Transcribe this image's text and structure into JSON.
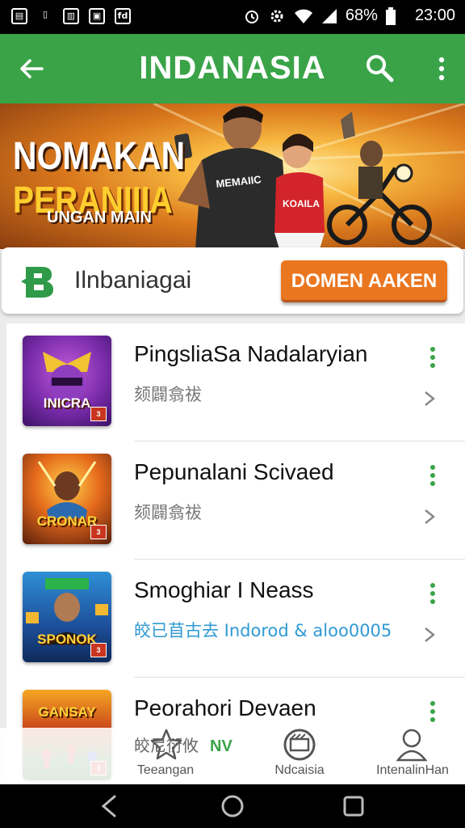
{
  "status_bar": {
    "battery": "68%",
    "time": "23:00"
  },
  "app_bar": {
    "title": "INDANASIA",
    "back_icon": "arrow-left-icon",
    "search_icon": "search-icon",
    "menu_icon": "more-vert-icon"
  },
  "banner": {
    "line1": "NOMAKAN",
    "line2": "PERANIIIA",
    "line3": "UNGAN MAIN",
    "shirt1": "MEMAIIC",
    "shirt2": "KOAILA"
  },
  "action_card": {
    "logo_letter": "B",
    "name": "Ilnbaniagai",
    "button_label": "DOMEN AAKEN"
  },
  "colors": {
    "primary_green": "#3aa348",
    "cta_orange": "#ea7620",
    "link_blue": "#2f9ad2"
  },
  "list": {
    "items": [
      {
        "title": "PingsliaSa Nadalaryian",
        "subtitle": "颏闢翕祓",
        "thumb_caption": "INICRA"
      },
      {
        "title": "Pepunalani Scivaed",
        "subtitle": "颏闢翕祓",
        "thumb_caption": "CRONAR"
      },
      {
        "title": "Smoghiar I Neass",
        "subtitle": "皎已苜古去  Indorod & aloo0005",
        "thumb_caption": "SPONOK"
      },
      {
        "title": "Peorahori Devaen",
        "subtitle": "",
        "thumb_caption": "GANSAY"
      }
    ]
  },
  "bottom_nav": {
    "extra_text": "皎尼衍攸",
    "extra_badge": "NV",
    "items": [
      {
        "label": "Teeangan",
        "icon": "star-icon"
      },
      {
        "label": "Ndcaisia",
        "icon": "film-reel-icon"
      },
      {
        "label": "IntenalinHan",
        "icon": "person-icon"
      }
    ]
  }
}
